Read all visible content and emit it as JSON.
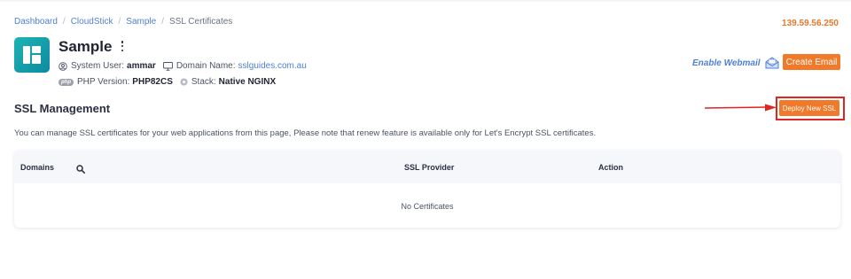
{
  "breadcrumb": {
    "items": [
      "Dashboard",
      "CloudStick",
      "Sample"
    ],
    "current": "SSL Certificates",
    "separator": "/"
  },
  "server_ip": "139.59.56.250",
  "app": {
    "name": "Sample",
    "system_user_label": "System User:",
    "system_user": "ammar",
    "domain_label": "Domain Name:",
    "domain": "sslguides.com.au",
    "php_badge": "php",
    "php_label": "PHP Version:",
    "php_version": "PHP82CS",
    "stack_label": "Stack:",
    "stack": "Native NGINX"
  },
  "header_actions": {
    "enable_webmail": "Enable Webmail",
    "create_email": "Create Email"
  },
  "ssl": {
    "title": "SSL Management",
    "deploy_button": "Deploy New SSL",
    "description": "You can manage SSL certificates for your web applications from this page, Please note that renew feature is available only for Let's Encrypt SSL certificates."
  },
  "table": {
    "columns": [
      "Domains",
      "SSL Provider",
      "Action"
    ],
    "empty_message": "No Certificates"
  },
  "colors": {
    "accent_orange": "#f0792a",
    "link_blue": "#4f7fd6",
    "annotation_red": "#e02424",
    "logo_teal": "#1cb4b3"
  }
}
